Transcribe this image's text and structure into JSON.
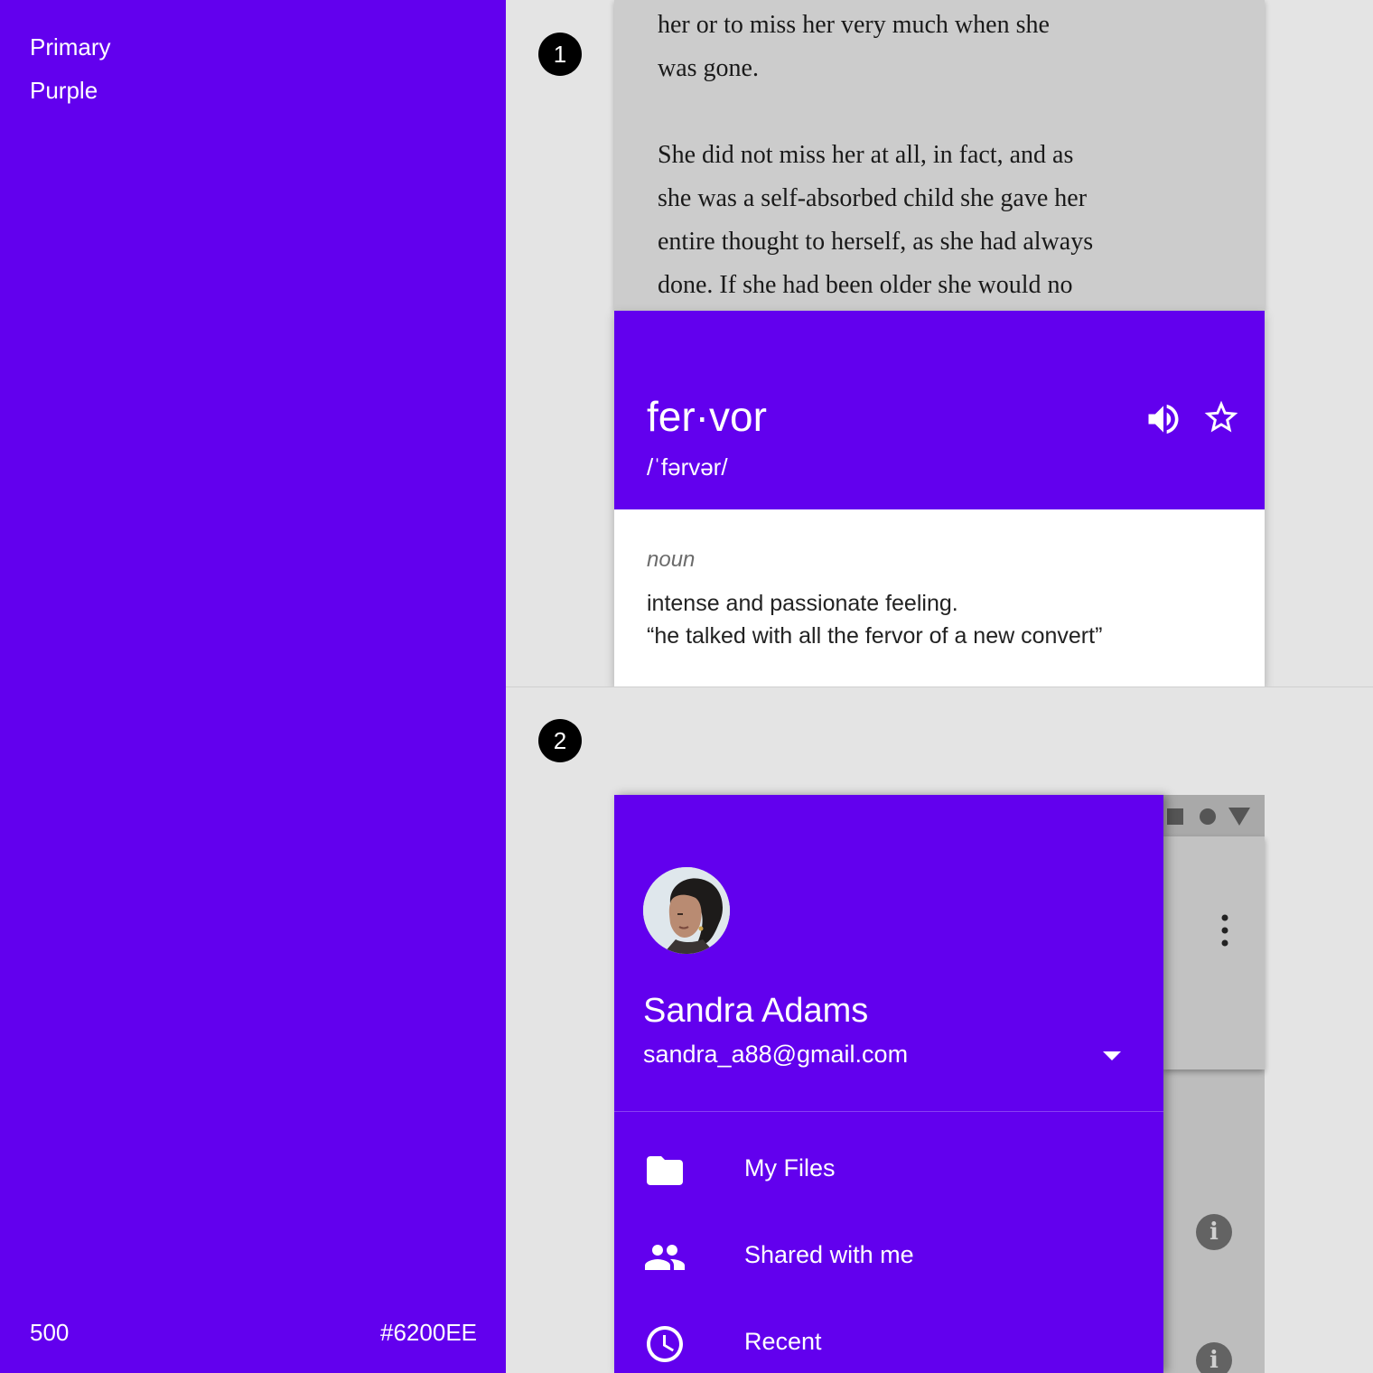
{
  "swatch": {
    "title_line1": "Primary",
    "title_line2": "Purple",
    "shade": "500",
    "hex": "#6200EE",
    "color": "#6200EE"
  },
  "example1": {
    "badge": "1",
    "book_lines": [
      "her or to miss her very much when she",
      "was gone.",
      "She did not miss her at all, in fact, and as",
      "she was a self-absorbed child she gave her",
      "entire thought to herself, as she had always",
      "done. If she had been older she would no"
    ],
    "dictionary": {
      "word": "fer·vor",
      "phonetic": "/ˈfərvər/",
      "part_of_speech": "noun",
      "definition": "intense and passionate feeling.",
      "example": "“he talked with all the fervor of a new convert”",
      "speaker_icon": "volume-up-icon",
      "star_icon": "star-outline-icon"
    }
  },
  "example2": {
    "badge": "2",
    "user": {
      "name": "Sandra Adams",
      "email": "sandra_a88@gmail.com"
    },
    "nav": [
      {
        "label": "My Files",
        "icon": "folder-icon"
      },
      {
        "label": "Shared with me",
        "icon": "people-icon"
      },
      {
        "label": "Recent",
        "icon": "clock-icon"
      }
    ],
    "info_glyph": "i"
  }
}
